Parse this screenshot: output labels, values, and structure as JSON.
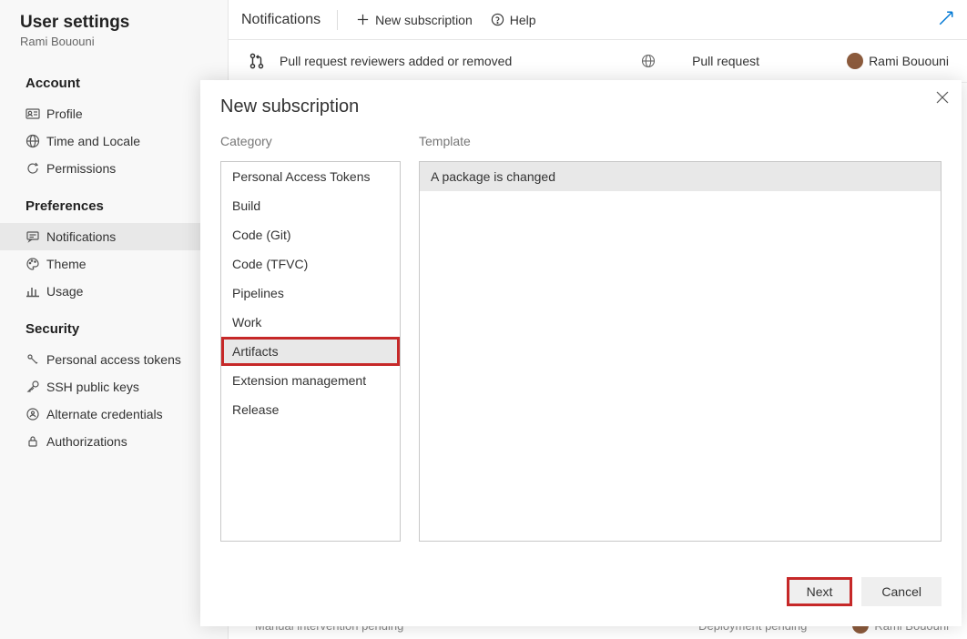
{
  "sidebar": {
    "title": "User settings",
    "subtitle": "Rami Bououni",
    "sections": {
      "account": {
        "title": "Account",
        "items": [
          "Profile",
          "Time and Locale",
          "Permissions"
        ]
      },
      "preferences": {
        "title": "Preferences",
        "items": [
          "Notifications",
          "Theme",
          "Usage"
        ]
      },
      "security": {
        "title": "Security",
        "items": [
          "Personal access tokens",
          "SSH public keys",
          "Alternate credentials",
          "Authorizations"
        ]
      }
    }
  },
  "toolbar": {
    "title": "Notifications",
    "new_subscription": "New subscription",
    "help": "Help"
  },
  "row": {
    "description": "Pull request reviewers added or removed",
    "type": "Pull request",
    "user": "Rami Bououni"
  },
  "row2": {
    "description": "Manual intervention pending",
    "type": "Deployment pending",
    "user": "Rami Bououni"
  },
  "dialog": {
    "title": "New subscription",
    "category_label": "Category",
    "template_label": "Template",
    "categories": [
      "Personal Access Tokens",
      "Build",
      "Code (Git)",
      "Code (TFVC)",
      "Pipelines",
      "Work",
      "Artifacts",
      "Extension management",
      "Release"
    ],
    "templates": [
      "A package is changed"
    ],
    "next": "Next",
    "cancel": "Cancel"
  }
}
